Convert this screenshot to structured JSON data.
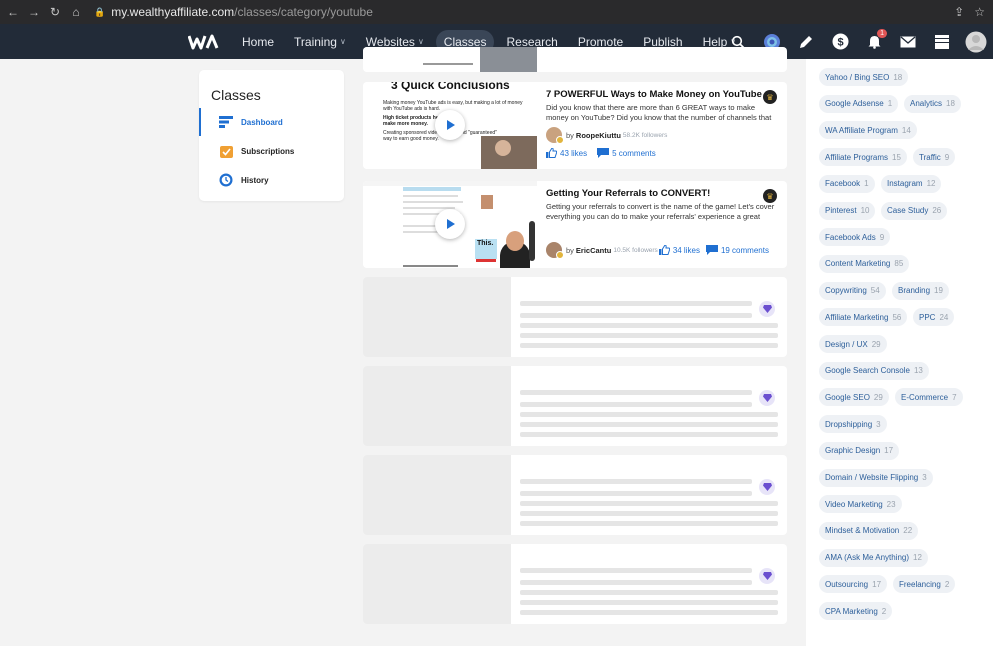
{
  "browser": {
    "url_host": "my.wealthyaffiliate.com",
    "url_path": "/classes/category/youtube"
  },
  "nav": {
    "logo": "WA",
    "items": [
      {
        "label": "Home",
        "dropdown": false
      },
      {
        "label": "Training",
        "dropdown": true
      },
      {
        "label": "Websites",
        "dropdown": true
      },
      {
        "label": "Classes",
        "dropdown": false,
        "active": true
      },
      {
        "label": "Research",
        "dropdown": false
      },
      {
        "label": "Promote",
        "dropdown": false
      },
      {
        "label": "Publish",
        "dropdown": false
      },
      {
        "label": "Help",
        "dropdown": true
      }
    ],
    "notification_count": "1",
    "icons": [
      "search-icon",
      "chat-icon",
      "pencil-icon",
      "dollar-icon",
      "bell-icon",
      "mail-icon",
      "inbox-icon",
      "avatar"
    ]
  },
  "sidebar": {
    "title": "Classes",
    "items": [
      {
        "label": "Dashboard",
        "icon": "dashboard-icon",
        "active": true
      },
      {
        "label": "Subscriptions",
        "icon": "subscriptions-icon",
        "active": false
      },
      {
        "label": "History",
        "icon": "history-icon",
        "active": false
      }
    ]
  },
  "cards": [
    {
      "title": "7 POWERFUL Ways to Make Money on YouTube",
      "description": "Did you know that there are more than 6 GREAT ways to make money on YouTube? Did you know that the number of channels that earn over",
      "author_prefix": "by",
      "author": "RoopeKiuttu",
      "followers": "58.2K followers",
      "likes": "43 likes",
      "comments": "5 comments",
      "thumb_heading": "3 Quick Conclusions",
      "thumb_lines": [
        "Making money YouTube ads is easy, but making a lot of money with YouTube ads is hard.",
        "High ticket products help you make more money.",
        "Creating sponsored videos is fast and \"guaranteed\" way to earn good money."
      ]
    },
    {
      "title": "Getting Your Referrals to CONVERT!",
      "description": "Getting your referrals to convert is the name of the game! Let's cover everything you can do to make your referrals' experience a great one,",
      "author_prefix": "by",
      "author": "EricCantu",
      "followers": "10.5K followers",
      "likes": "34 likes",
      "comments": "19 comments",
      "thumb_text": "This."
    }
  ],
  "tags": [
    {
      "label": "Yahoo / Bing SEO",
      "count": "18"
    },
    {
      "label": "Google Adsense",
      "count": "1"
    },
    {
      "label": "Analytics",
      "count": "18"
    },
    {
      "label": "WA Affiliate Program",
      "count": "14"
    },
    {
      "label": "Affiliate Programs",
      "count": "15"
    },
    {
      "label": "Traffic",
      "count": "9"
    },
    {
      "label": "Facebook",
      "count": "1"
    },
    {
      "label": "Instagram",
      "count": "12"
    },
    {
      "label": "Pinterest",
      "count": "10"
    },
    {
      "label": "Case Study",
      "count": "26"
    },
    {
      "label": "Facebook Ads",
      "count": "9"
    },
    {
      "label": "Content Marketing",
      "count": "85"
    },
    {
      "label": "Copywriting",
      "count": "54"
    },
    {
      "label": "Branding",
      "count": "19"
    },
    {
      "label": "Affiliate Marketing",
      "count": "56"
    },
    {
      "label": "PPC",
      "count": "24"
    },
    {
      "label": "Design / UX",
      "count": "29"
    },
    {
      "label": "Google Search Console",
      "count": "13"
    },
    {
      "label": "Google SEO",
      "count": "29"
    },
    {
      "label": "E-Commerce",
      "count": "7"
    },
    {
      "label": "Dropshipping",
      "count": "3"
    },
    {
      "label": "Graphic Design",
      "count": "17"
    },
    {
      "label": "Domain / Website Flipping",
      "count": "3"
    },
    {
      "label": "Video Marketing",
      "count": "23"
    },
    {
      "label": "Mindset & Motivation",
      "count": "22"
    },
    {
      "label": "AMA (Ask Me Anything)",
      "count": "12"
    },
    {
      "label": "Outsourcing",
      "count": "17"
    },
    {
      "label": "Freelancing",
      "count": "2"
    },
    {
      "label": "CPA Marketing",
      "count": "2"
    }
  ],
  "colors": {
    "nav_bg": "#222b38",
    "accent": "#1f6fd1",
    "tag_text": "#2d5f9a"
  }
}
